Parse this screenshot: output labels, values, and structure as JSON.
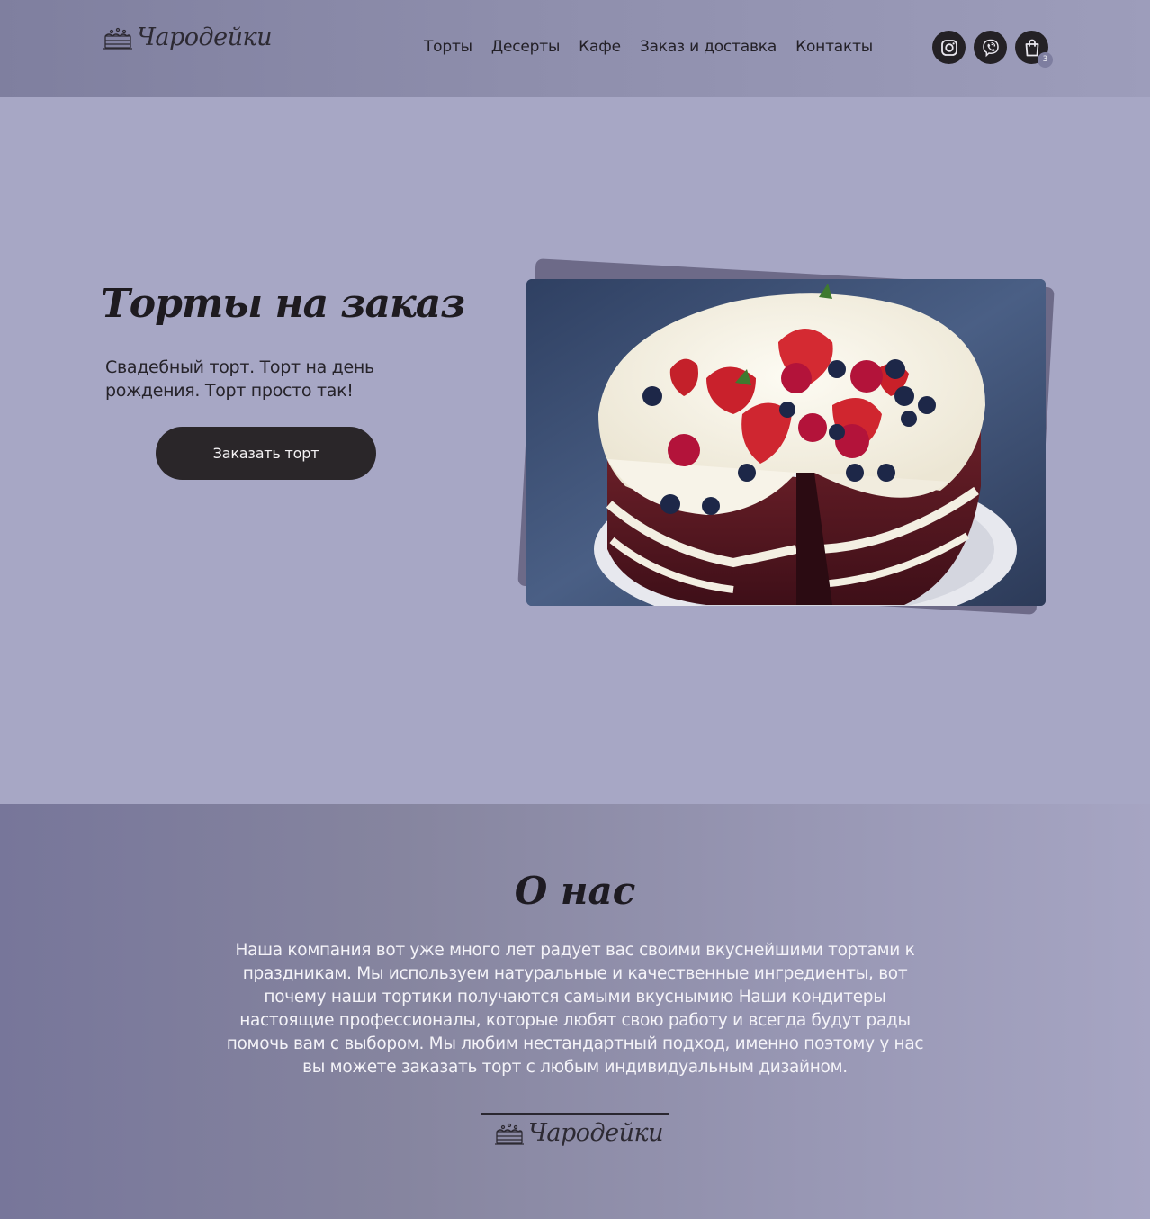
{
  "header": {
    "logo_text": "Чародейки",
    "nav": [
      {
        "label": "Торты"
      },
      {
        "label": "Десерты"
      },
      {
        "label": "Кафе"
      },
      {
        "label": "Заказ и доставка"
      },
      {
        "label": "Контакты"
      }
    ],
    "icons": [
      "instagram-icon",
      "viber-icon",
      "shopping-bag-icon"
    ],
    "cart_count": "3"
  },
  "hero": {
    "title": "Торты на заказ",
    "subtitle": "Свадебный торт. Торт на день рождения. Торт просто так!",
    "button_label": "Заказать торт",
    "image": "cake-with-berries-photo"
  },
  "about": {
    "title": "О нас",
    "text": "Наша компания вот уже много лет радует вас своими вкуснейшими тортами к праздникам. Мы используем натуральные и качественные ингредиенты, вот почему наши тортики получаются самыми вкуснымию Наши кондитеры настоящие профессионалы, которые любят свою работу и всегда будут рады помочь вам с выбором. Мы любим нестандартный подход, именно поэтому у нас вы можете заказать торт с любым индивидуальным дизайном.",
    "logo_text": "Чародейки"
  },
  "colors": {
    "header_bg": "#8e8eac",
    "hero_bg": "#a7a7c5",
    "button_bg": "#2a2629",
    "icon_bg": "#242125",
    "photo_shadow": "#6d6a88"
  }
}
